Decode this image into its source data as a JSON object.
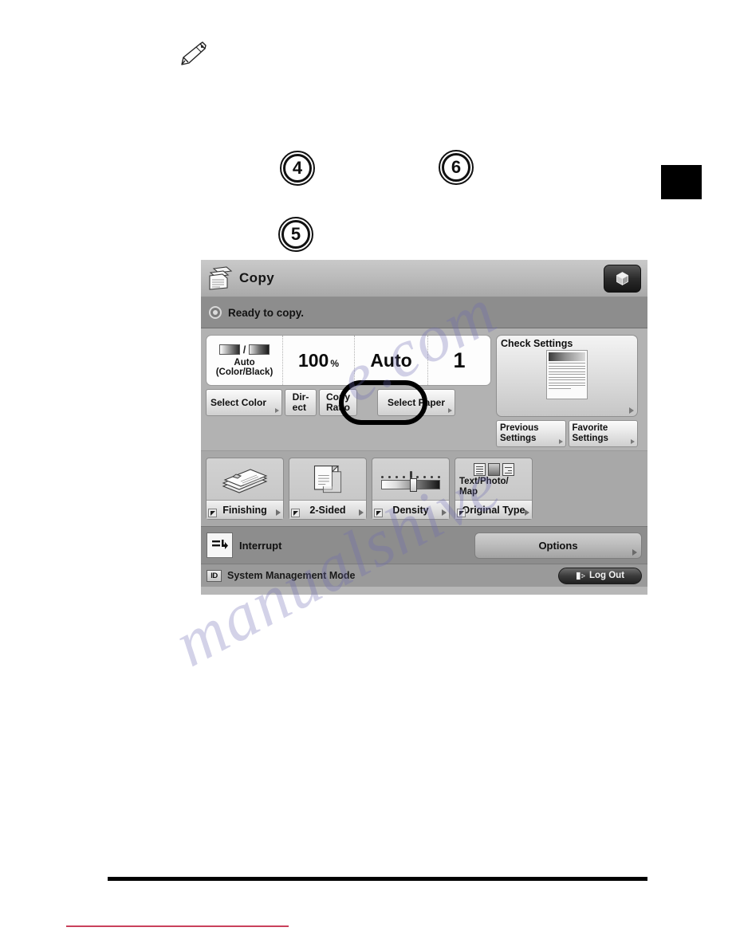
{
  "page": {
    "pencil_icon": "pencil-icon",
    "black_tab": "black-page-tab"
  },
  "callouts": [
    {
      "number": "4"
    },
    {
      "number": "6"
    },
    {
      "number": "5"
    }
  ],
  "watermark": {
    "line1": "e.com",
    "line2": "manualshive",
    "line3": "s"
  },
  "copier": {
    "titlebar": {
      "icon": "copy-document-icon",
      "title": "Copy",
      "cube_button_icon": "cube-icon"
    },
    "status": {
      "icon": "status-indicator-icon",
      "text": "Ready to copy."
    },
    "readouts": {
      "color_mode": {
        "icon": "color-black-swatch-icon",
        "line1": "Auto",
        "line2": "(Color/Black)"
      },
      "copy_ratio": {
        "value": "100",
        "unit": "%"
      },
      "paper": {
        "value": "Auto"
      },
      "quantity": {
        "value": "1"
      }
    },
    "mini_buttons": {
      "select_color": "Select Color",
      "direct": "Dir-\nect",
      "copy_ratio": "Copy\nRatio",
      "select_paper": "Select Paper"
    },
    "check_settings": {
      "title": "Check Settings",
      "thumbnail_icon": "document-preview-icon",
      "previous_settings": "Previous\nSettings",
      "favorite_settings": "Favorite\nSettings"
    },
    "functions": [
      {
        "label": "Finishing",
        "icon": "finishing-stack-icon"
      },
      {
        "label": "2-Sided",
        "icon": "two-sided-page-icon"
      },
      {
        "label": "Density",
        "icon": "density-slider-icon"
      },
      {
        "label": "Original Type",
        "icon": "original-type-icon",
        "value": "Text/Photo/\nMap"
      }
    ],
    "strip": {
      "interrupt_icon": "interrupt-icon",
      "interrupt_label": "Interrupt",
      "options_label": "Options"
    },
    "footer": {
      "id_badge": "ID",
      "mode_text": "System Management Mode",
      "logout_icon": "logout-icon",
      "logout_label": "Log Out"
    }
  },
  "colors": {
    "screen_bg": "#b2b2b2",
    "titlebar": "#bcbcbc",
    "statusbar": "#8d8d8d",
    "func_area": "#a8a8a8",
    "footer": "#9a9a9a",
    "highlight": "#000000",
    "rule_red": "#c9405c"
  }
}
